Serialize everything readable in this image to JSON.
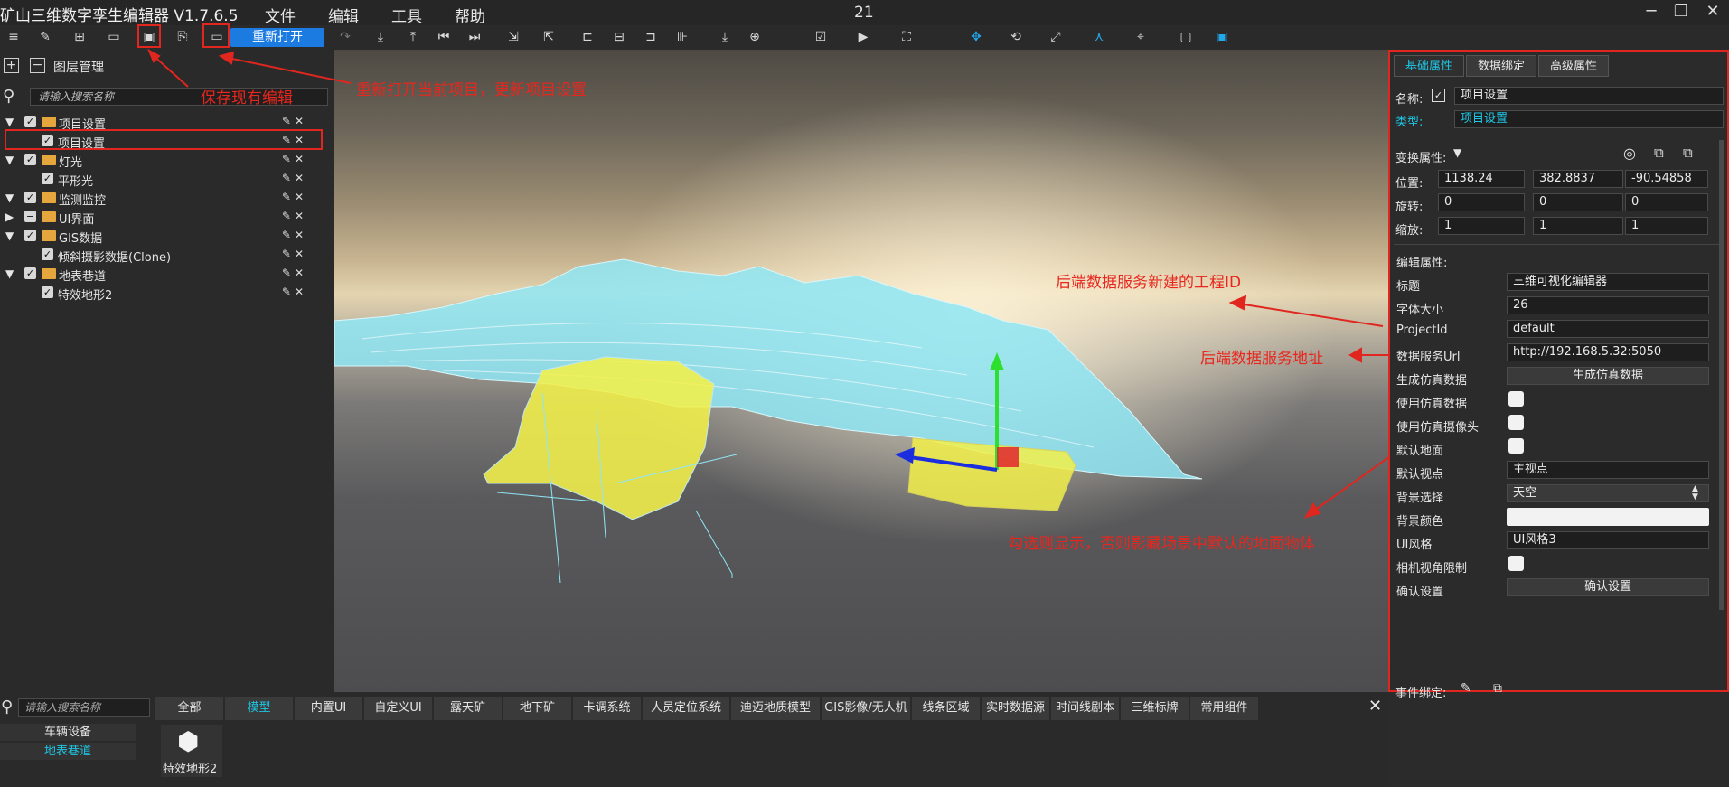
{
  "titlebar": {
    "app_title": "矿山三维数字孪生编辑器 V1.7.6.5",
    "menus": [
      "文件",
      "编辑",
      "工具",
      "帮助"
    ],
    "center_number": "21",
    "win_min": "─",
    "win_max": "❐",
    "win_close": "✕"
  },
  "toolbar": {
    "reopen_label": "重新打开"
  },
  "layers": {
    "title": "图层管理",
    "search_placeholder": "请输入搜索名称",
    "items": [
      {
        "label": "项目设置",
        "level": 0
      },
      {
        "label": "项目设置",
        "level": 1
      },
      {
        "label": "灯光",
        "level": 0
      },
      {
        "label": "平形光",
        "level": 1
      },
      {
        "label": "监测监控",
        "level": 0
      },
      {
        "label": "UI界面",
        "level": 0
      },
      {
        "label": "GIS数据",
        "level": 0
      },
      {
        "label": "倾斜摄影数据(Clone)",
        "level": 1
      },
      {
        "label": "地表巷道",
        "level": 0
      },
      {
        "label": "特效地形2",
        "level": 1
      }
    ]
  },
  "annotations": {
    "save": "保存现有编辑",
    "reopen": "重新打开当前项目，更新项目设置",
    "project_id": "后端数据服务新建的工程ID",
    "service_url": "后端数据服务地址",
    "ground": "勾选则显示，否则影藏场景中默认的地面物体"
  },
  "properties": {
    "tabs": [
      "基础属性",
      "数据绑定",
      "高级属性"
    ],
    "name_label": "名称:",
    "name_value": "项目设置",
    "type_label": "类型:",
    "type_value": "项目设置",
    "transform_label": "变换属性:",
    "position_label": "位置:",
    "position": [
      "1138.24",
      "382.8837",
      "-90.54858"
    ],
    "rotation_label": "旋转:",
    "rotation": [
      "0",
      "0",
      "0"
    ],
    "scale_label": "缩放:",
    "scale": [
      "1",
      "1",
      "1"
    ],
    "edit_label": "编辑属性:",
    "title_label": "标题",
    "title_value": "三维可视化编辑器",
    "fontsize_label": "字体大小",
    "fontsize_value": "26",
    "projectid_label": "ProjectId",
    "projectid_value": "default",
    "url_label": "数据服务Url",
    "url_value": "http://192.168.5.32:5050",
    "gen_label": "生成仿真数据",
    "gen_button": "生成仿真数据",
    "use_sim_label": "使用仿真数据",
    "use_cam_label": "使用仿真摄像头",
    "default_ground_label": "默认地面",
    "default_view_label": "默认视点",
    "default_view_value": "主视点",
    "bg_select_label": "背景选择",
    "bg_select_value": "天空",
    "bg_color_label": "背景颜色",
    "ui_style_label": "UI风格",
    "ui_style_value": "UI风格3",
    "cam_limit_label": "相机视角限制",
    "confirm_label": "确认设置",
    "confirm_button": "确认设置",
    "event_label": "事件绑定:"
  },
  "assets": {
    "search_placeholder": "请输入搜索名称",
    "categories": [
      "车辆设备",
      "地表巷道"
    ],
    "tabs": [
      "全部",
      "模型",
      "内置UI",
      "自定义UI",
      "露天矿",
      "地下矿",
      "卡调系统",
      "人员定位系统",
      "迪迈地质模型",
      "GIS影像/无人机",
      "线条区域",
      "实时数据源",
      "时间线剧本",
      "三维标牌",
      "常用组件"
    ],
    "active_tab": "模型",
    "items": [
      "特效地形2"
    ]
  },
  "colors": {
    "accent": "#1ec7e6",
    "button_blue": "#1c7be0",
    "annotation_red": "#e0261f",
    "folder": "#e6a63e",
    "model_yellow": "#f2f04a",
    "terrain_cyan": "#8fe6f5"
  }
}
